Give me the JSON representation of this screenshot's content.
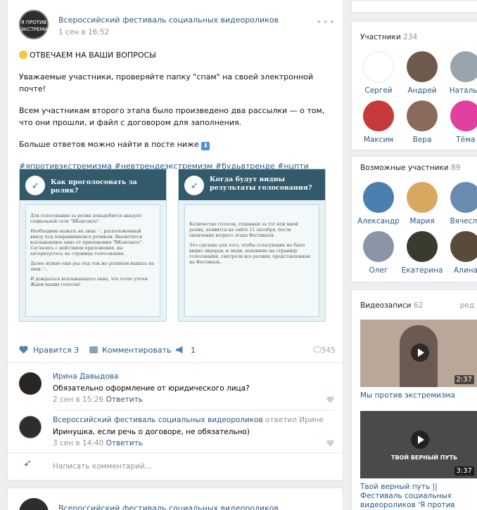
{
  "post": {
    "author": "Всероссийский фестиваль социальных видеороликов",
    "avatar_text": "Я ПРОТИВ ЭКСТРЕМИЗМА",
    "date": "1 сен в 16:52",
    "headline": "ОТВЕЧАЕМ НА ВАШИ ВОПРОСЫ",
    "para1": "Уважаемые участники, проверяйте папку \"спам\" на своей электронной почте!",
    "para2": "Всем участникам второго этапа было произведено два рассылки — о том, что они прошли, и файл с договором для заполнения.",
    "para3": "Больше ответов можно найти в посте ниже",
    "hashtags": "#япротивэкстремизма #невтрендеэкстремизм #будьвтренде #нцпти",
    "card1": {
      "title": "Как проголосовать за ролик?",
      "p1": "Для голосования за ролик понадобится аккаунт социальной сети \"ВКонтакте\".",
      "p2": "Необходимо нажать на знак ♡, расположенный внизу под понравившемся роликом. Высветится всплывающее окно от приложения \"ВКонтакте\". Согласись с действием приложения, вы авторизуетесь на странице голосования.",
      "p3": "Далее нужно еще раз под тем же роликом нажать на знак ♡.",
      "p4": "И дождаться всплывающего окна, что голос учтен. Ждем ваших голосов!"
    },
    "card2": {
      "title": "Когда будут видны результаты голосования?",
      "p1": "Количество голосов, отданных за тот или иной ролик, появится на сайте 11 октября, после окончания второго этапа Фестиваля.",
      "p2": "Это сделано для того, чтобы голосующие не было видно лидеров, и люди, попавшие на страницу голосования, смотрели все ролики, представленные на Фестиваль."
    },
    "likes_label": "Нравится 3",
    "comment_label": "Комментировать",
    "shares": "1",
    "views": "345"
  },
  "comments": [
    {
      "name": "Ирина Давыдова",
      "text": "Обязательно оформление от юридического лица?",
      "date": "2 сен в 15:26",
      "reply": "Ответить"
    },
    {
      "name": "Всероссийский фестиваль социальных видеороликов",
      "answered": "ответил Ирине",
      "text": "Иринушка, если речь о договоре, не обязательно)",
      "date": "3 сен в 14:40",
      "reply": "Ответить"
    }
  ],
  "write_placeholder": "Написать комментарий...",
  "post2": {
    "author": "Всероссийский фестиваль социальных видеороликов"
  },
  "members": {
    "title": "Участники",
    "count": "234",
    "items": [
      {
        "name": "Сергей",
        "color": "#ffffff"
      },
      {
        "name": "Андрей",
        "color": "#6e5a4d"
      },
      {
        "name": "Натальи",
        "color": "#9aa4ad"
      },
      {
        "name": "Максим",
        "color": "#c83a3a"
      },
      {
        "name": "Вера",
        "color": "#8a6a5a"
      },
      {
        "name": "Тёма",
        "color": "#e040a0"
      }
    ]
  },
  "possible": {
    "title": "Возможные участники",
    "count": "89",
    "items": [
      {
        "name": "Александр",
        "color": "#4a7fb0"
      },
      {
        "name": "Мария",
        "color": "#d9a860"
      },
      {
        "name": "Вячесла",
        "color": "#6a8ab0"
      },
      {
        "name": "Олег",
        "color": "#8a96a8"
      },
      {
        "name": "Екатерина",
        "color": "#3a3a2e"
      },
      {
        "name": "Алина",
        "color": "#5a4a3a"
      }
    ]
  },
  "videos": {
    "title": "Видеозаписи",
    "count": "62",
    "edit": "ред",
    "items": [
      {
        "title": "Мы против экстремизма",
        "duration": "2:37",
        "thumb_color": "#b9a89a"
      },
      {
        "title": "Твой верный путь || Фестиваль социальных видеороликов 'Я против экстремизма'",
        "duration": "3:37",
        "overlay": "ТВОЙ ВЕРНЫЙ ПУТЬ",
        "thumb_color": "#4a4a4a"
      }
    ]
  }
}
